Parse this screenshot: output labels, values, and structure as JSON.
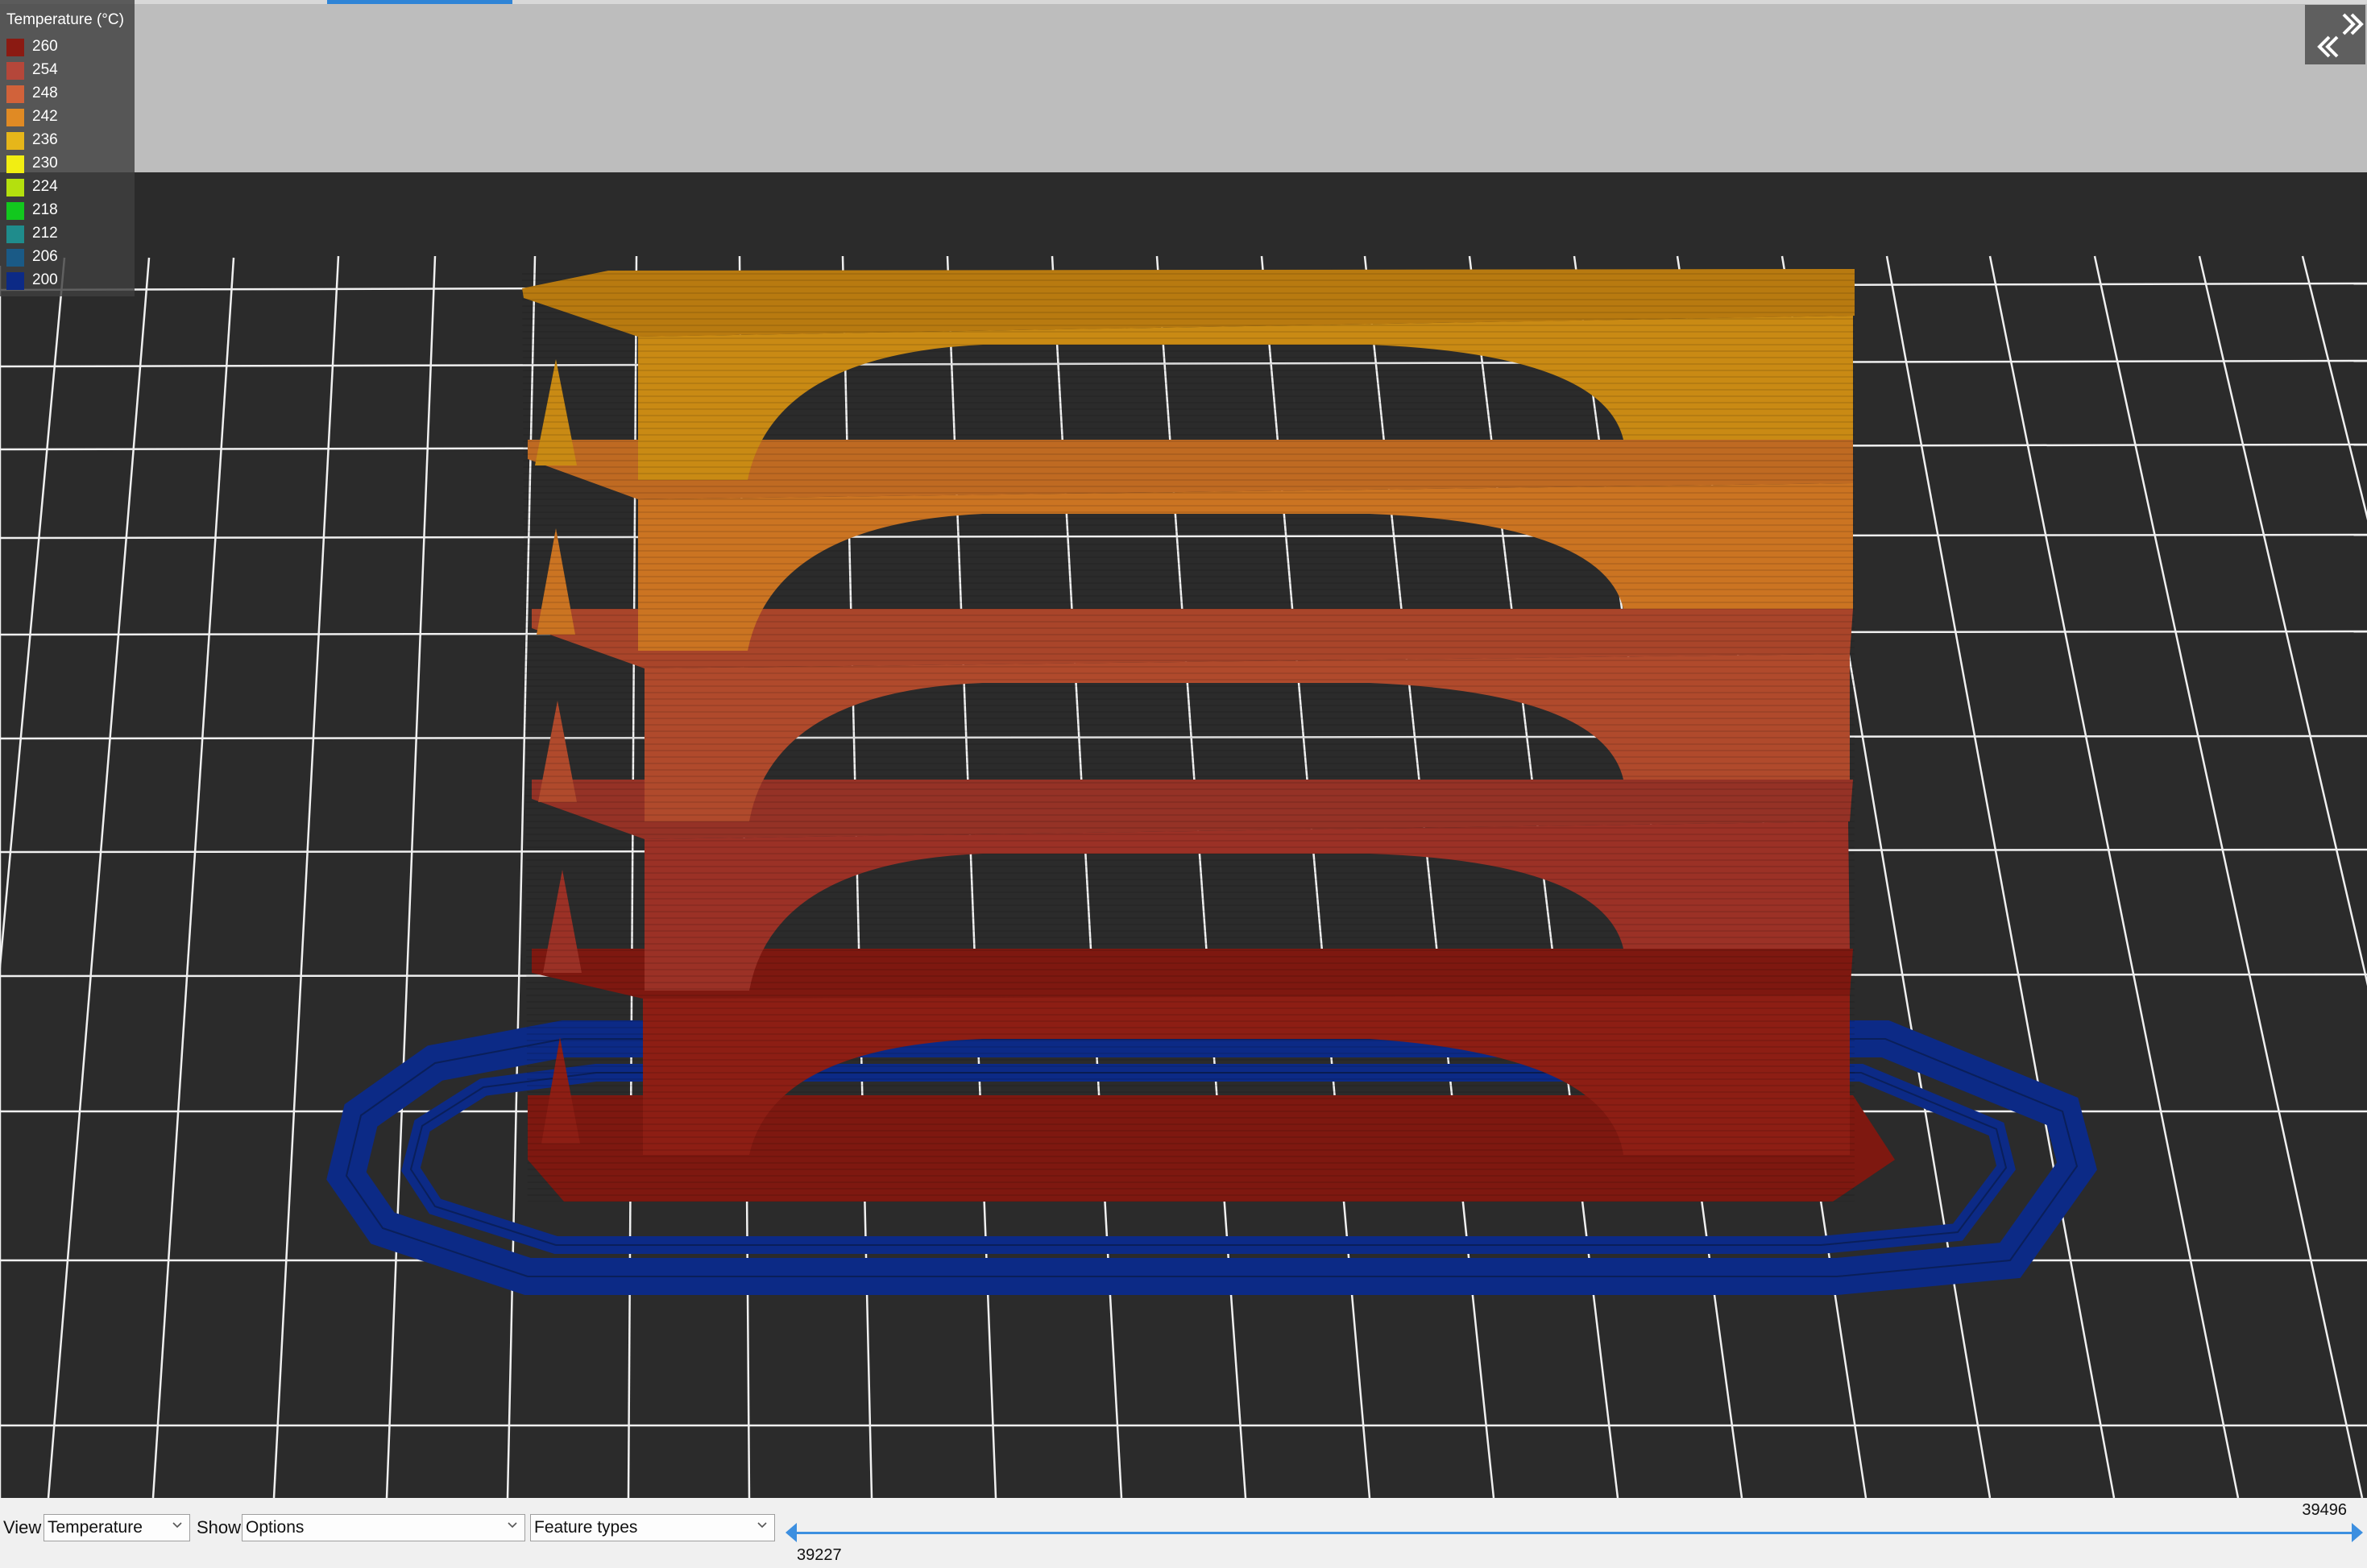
{
  "legend": {
    "title": "Temperature (°C)",
    "items": [
      {
        "label": "260",
        "color": "#8b1a12"
      },
      {
        "label": "254",
        "color": "#b5473a"
      },
      {
        "label": "248",
        "color": "#d1623a"
      },
      {
        "label": "242",
        "color": "#e08a24"
      },
      {
        "label": "236",
        "color": "#e6b61a"
      },
      {
        "label": "230",
        "color": "#f2ee12"
      },
      {
        "label": "224",
        "color": "#b4e00e"
      },
      {
        "label": "218",
        "color": "#12c81e"
      },
      {
        "label": "212",
        "color": "#1f8c8c"
      },
      {
        "label": "206",
        "color": "#1a5a86"
      },
      {
        "label": "200",
        "color": "#0c2a86"
      }
    ]
  },
  "toolbar": {
    "view_label": "View",
    "view_value": "Temperature",
    "show_label": "Show",
    "show_value": "Options",
    "feature_value": "Feature types"
  },
  "slider": {
    "high_value": "39496",
    "low_value": "39227"
  },
  "colors": {
    "bed": "#2b2b2b",
    "grid": "#f2f2f2",
    "sky": "#bdbdbd",
    "accent": "#3c8fe0",
    "skirt": "#0c2a86"
  },
  "icons": {
    "collapse": "double-chevron-icon"
  }
}
